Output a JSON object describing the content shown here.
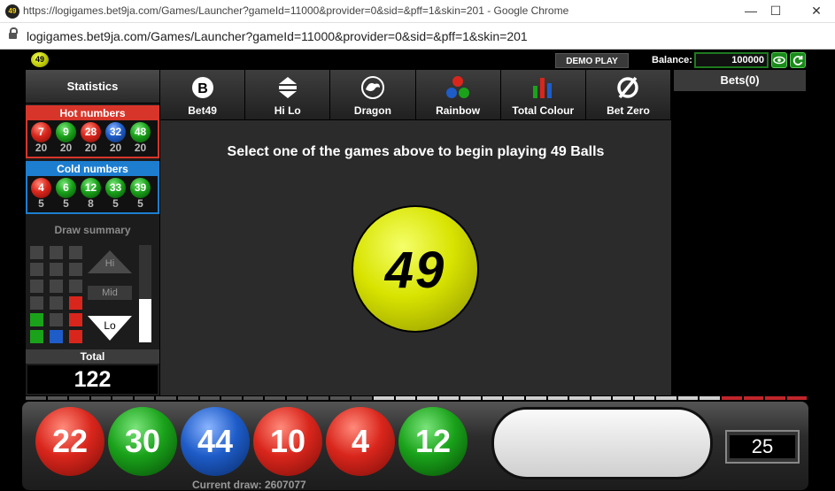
{
  "browser": {
    "title": "https://logigames.bet9ja.com/Games/Launcher?gameId=11000&provider=0&sid=&pff=1&skin=201 - Google Chrome",
    "address": "logigames.bet9ja.com/Games/Launcher?gameId=11000&provider=0&sid=&pff=1&skin=201",
    "favicon": "49"
  },
  "topbar": {
    "logo": "49",
    "demo_label": "DEMO PLAY",
    "balance_label": "Balance:",
    "balance_value": "100000",
    "eye_icon": "eye-icon",
    "refresh_icon": "refresh-icon"
  },
  "left": {
    "statistics_label": "Statistics",
    "hot_title": "Hot numbers",
    "hot": [
      {
        "num": "7",
        "count": "20",
        "color": "red"
      },
      {
        "num": "9",
        "count": "20",
        "color": "green"
      },
      {
        "num": "28",
        "count": "20",
        "color": "red"
      },
      {
        "num": "32",
        "count": "20",
        "color": "blue"
      },
      {
        "num": "48",
        "count": "20",
        "color": "green"
      }
    ],
    "cold_title": "Cold numbers",
    "cold": [
      {
        "num": "4",
        "count": "5",
        "color": "red"
      },
      {
        "num": "6",
        "count": "5",
        "color": "green"
      },
      {
        "num": "12",
        "count": "8",
        "color": "green"
      },
      {
        "num": "33",
        "count": "5",
        "color": "green"
      },
      {
        "num": "39",
        "count": "5",
        "color": "green"
      }
    ],
    "draw_summary_title": "Draw summary",
    "hi_label": "Hi",
    "mid_label": "Mid",
    "lo_label": "Lo",
    "lo_fraction": 0.45,
    "total_label": "Total",
    "total_value": "122"
  },
  "tabs": [
    {
      "label": "Bet49",
      "icon": "b-circle-icon"
    },
    {
      "label": "Hi Lo",
      "icon": "hi-lo-arrows-icon"
    },
    {
      "label": "Dragon",
      "icon": "dragon-icon"
    },
    {
      "label": "Rainbow",
      "icon": "rainbow-balls-icon"
    },
    {
      "label": "Total Colour",
      "icon": "bar-chart-icon"
    },
    {
      "label": "Bet Zero",
      "icon": "zero-slash-icon"
    }
  ],
  "main": {
    "prompt": "Select one of the games above to begin playing 49 Balls",
    "logo_ball": "49"
  },
  "bets": {
    "title": "Bets(0)"
  },
  "draw": {
    "balls": [
      {
        "num": "22",
        "color": "red"
      },
      {
        "num": "30",
        "color": "green"
      },
      {
        "num": "44",
        "color": "blue"
      },
      {
        "num": "10",
        "color": "red"
      },
      {
        "num": "4",
        "color": "red"
      },
      {
        "num": "12",
        "color": "green"
      }
    ],
    "counter": "25",
    "current_draw": "Current draw: 2607077"
  },
  "colors": {
    "red": "#d9261c",
    "green": "#1aa21a",
    "blue": "#1e5cc8",
    "hot_border": "#d8352a",
    "cold_border": "#1d7ed0"
  }
}
